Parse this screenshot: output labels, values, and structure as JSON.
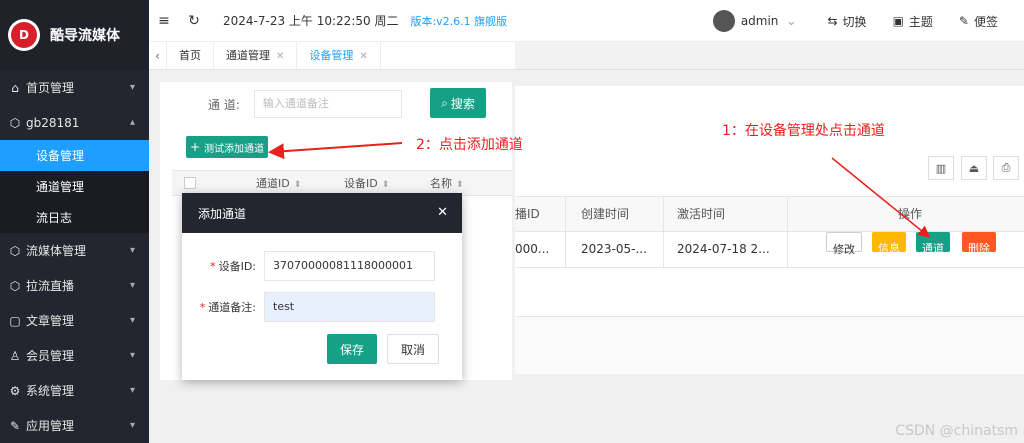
{
  "brand": {
    "name": "酷导流媒体",
    "logo_glyph": "D"
  },
  "sidebar": {
    "items": [
      {
        "label": "首页管理",
        "icon": "home-icon"
      },
      {
        "label": "gb28181",
        "icon": "cube-icon"
      },
      {
        "label": "流媒体管理",
        "icon": "cube-icon"
      },
      {
        "label": "拉流直播",
        "icon": "cube-icon"
      },
      {
        "label": "文章管理",
        "icon": "document-icon"
      },
      {
        "label": "会员管理",
        "icon": "user-icon"
      },
      {
        "label": "系统管理",
        "icon": "gear-icon"
      },
      {
        "label": "应用管理",
        "icon": "wrench-icon"
      }
    ],
    "subitems": [
      {
        "label": "设备管理",
        "active": true
      },
      {
        "label": "通道管理"
      },
      {
        "label": "流日志"
      }
    ]
  },
  "topbar": {
    "datetime": "2024-7-23 上午 10:22:50 周二",
    "version": "版本:v2.6.1 旗舰版",
    "user": "admin",
    "switch_label": "切换",
    "theme_label": "主题",
    "note_label": "便签"
  },
  "tabs": [
    {
      "label": "首页"
    },
    {
      "label": "通道管理"
    },
    {
      "label": "设备管理"
    }
  ],
  "search": {
    "label": "通 道:",
    "placeholder": "输入通道备注",
    "button": "搜索"
  },
  "add_button": "测试添加通道",
  "left_table": {
    "headers": [
      "通道ID",
      "设备ID",
      "名称"
    ]
  },
  "right_table": {
    "headers": [
      "播ID",
      "创建时间",
      "激活时间",
      "操作"
    ],
    "row": {
      "id": "000...",
      "created": "2023-05-...",
      "activated": "2024-07-18 2..."
    },
    "actions": {
      "edit": "修改",
      "info": "信息",
      "channel": "通道",
      "delete": "删除"
    }
  },
  "annotations": {
    "step1": "1：在设备管理处点击通道",
    "step2": "2：点击添加通道"
  },
  "modal": {
    "title": "添加通道",
    "device_label": "设备ID:",
    "device_value": "37070000081118000001",
    "note_label": "通道备注:",
    "note_value": "test",
    "save": "保存",
    "cancel": "取消"
  },
  "watermark": "CSDN @chinatsm",
  "colors": {
    "accent": "#1e9fff",
    "primary_green": "#16a086",
    "sidebar_bg": "#23262e",
    "annotation_red": "#e8211d"
  }
}
